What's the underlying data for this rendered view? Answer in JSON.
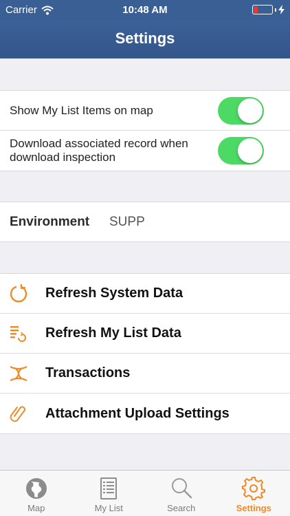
{
  "status_bar": {
    "carrier": "Carrier",
    "time": "10:48 AM",
    "battery_level": 0.15
  },
  "nav": {
    "title": "Settings"
  },
  "toggles": [
    {
      "label": "Show My List Items on map",
      "on": true
    },
    {
      "label": "Download associated record when download inspection",
      "on": true
    }
  ],
  "environment": {
    "label": "Environment",
    "value": "SUPP"
  },
  "actions": [
    {
      "label": "Refresh System Data",
      "icon": "refresh-icon"
    },
    {
      "label": "Refresh My List Data",
      "icon": "list-refresh-icon"
    },
    {
      "label": "Transactions",
      "icon": "transactions-icon"
    },
    {
      "label": "Attachment Upload Settings",
      "icon": "paperclip-icon"
    }
  ],
  "tabs": [
    {
      "label": "Map",
      "icon": "globe-icon",
      "active": false
    },
    {
      "label": "My List",
      "icon": "list-icon",
      "active": false
    },
    {
      "label": "Search",
      "icon": "magnifier-icon",
      "active": false
    },
    {
      "label": "Settings",
      "icon": "gear-icon",
      "active": true
    }
  ],
  "colors": {
    "nav_bar": "#3a5f95",
    "accent": "#ef8a24",
    "toggle_on": "#4cd964",
    "battery_low": "#e53935"
  }
}
